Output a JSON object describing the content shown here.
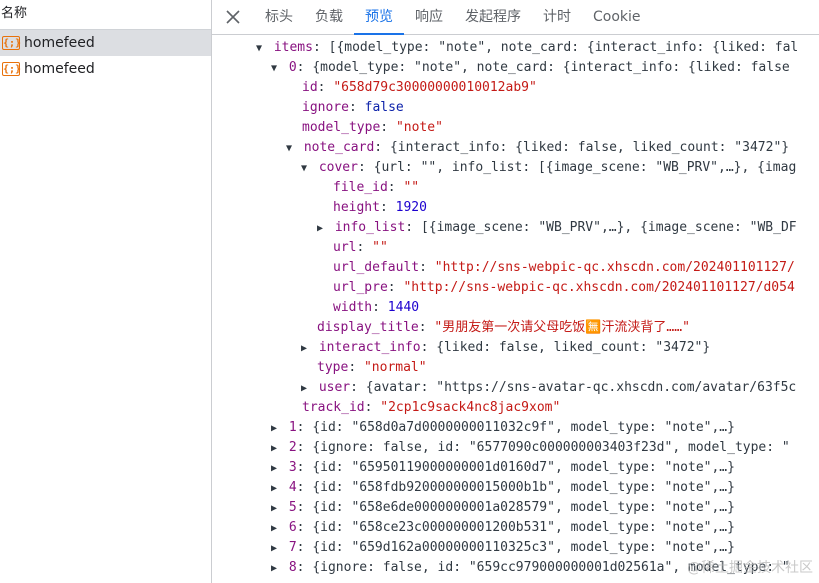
{
  "left_panel": {
    "header": "名称",
    "requests": [
      {
        "label": "homefeed",
        "selected": true
      },
      {
        "label": "homefeed",
        "selected": false
      }
    ]
  },
  "tabs": [
    "标头",
    "负载",
    "预览",
    "响应",
    "发起程序",
    "计时",
    "Cookie"
  ],
  "active_tab": "预览",
  "tree": {
    "items_key": "items",
    "items_summary": "[{model_type: \"note\", note_card: {interact_info: {liked: fal",
    "item0_key": "0",
    "item0_summary": "{model_type: \"note\", note_card: {interact_info: {liked: false",
    "id_key": "id",
    "id_value": "\"658d79c30000000010012ab9\"",
    "ignore_key": "ignore",
    "ignore_value": "false",
    "model_type_key": "model_type",
    "model_type_value": "\"note\"",
    "note_card_key": "note_card",
    "note_card_summary": "{interact_info: {liked: false, liked_count: \"3472\"}",
    "cover_key": "cover",
    "cover_summary": "{url: \"\", info_list: [{image_scene: \"WB_PRV\",…}, {imag",
    "file_id_key": "file_id",
    "file_id_value": "\"\"",
    "height_key": "height",
    "height_value": "1920",
    "info_list_key": "info_list",
    "info_list_summary": "[{image_scene: \"WB_PRV\",…}, {image_scene: \"WB_DF",
    "url_key": "url",
    "url_value": "\"\"",
    "url_default_key": "url_default",
    "url_default_value": "\"http://sns-webpic-qc.xhscdn.com/202401101127/",
    "url_pre_key": "url_pre",
    "url_pre_value": "\"http://sns-webpic-qc.xhscdn.com/202401101127/d054",
    "width_key": "width",
    "width_value": "1440",
    "display_title_key": "display_title",
    "display_title_value": "\"男朋友第一次请父母吃饭🈚汗流浃背了……\"",
    "interact_info_key": "interact_info",
    "interact_info_summary": "{liked: false, liked_count: \"3472\"}",
    "type_key": "type",
    "type_value": "\"normal\"",
    "user_key": "user",
    "user_summary": "{avatar: \"https://sns-avatar-qc.xhscdn.com/avatar/63f5c",
    "track_id_key": "track_id",
    "track_id_value": "\"2cp1c9sack4nc8jac9xom\"",
    "items": [
      {
        "key": "1",
        "summary": "{id: \"658d0a7d0000000011032c9f\", model_type: \"note\",…}"
      },
      {
        "key": "2",
        "summary": "{ignore: false, id: \"6577090c000000003403f23d\", model_type: \""
      },
      {
        "key": "3",
        "summary": "{id: \"65950119000000001d0160d7\", model_type: \"note\",…}"
      },
      {
        "key": "4",
        "summary": "{id: \"658fdb920000000015000b1b\", model_type: \"note\",…}"
      },
      {
        "key": "5",
        "summary": "{id: \"658e6de0000000001a028579\", model_type: \"note\",…}"
      },
      {
        "key": "6",
        "summary": "{id: \"658ce23c000000001200b531\", model_type: \"note\",…}"
      },
      {
        "key": "7",
        "summary": "{id: \"659d162a00000000110325c3\", model_type: \"note\",…}"
      },
      {
        "key": "8",
        "summary": "{ignore: false, id: \"659cc979000000001d02561a\", model_type: \""
      }
    ]
  },
  "watermark": "@稀土掘金技术社区",
  "colors": {
    "accent": "#1a73e8",
    "key": "#881280",
    "string": "#c41a16",
    "number": "#1c00cf",
    "boolean": "#0d22aa",
    "selected_row": "#dcdee2"
  }
}
